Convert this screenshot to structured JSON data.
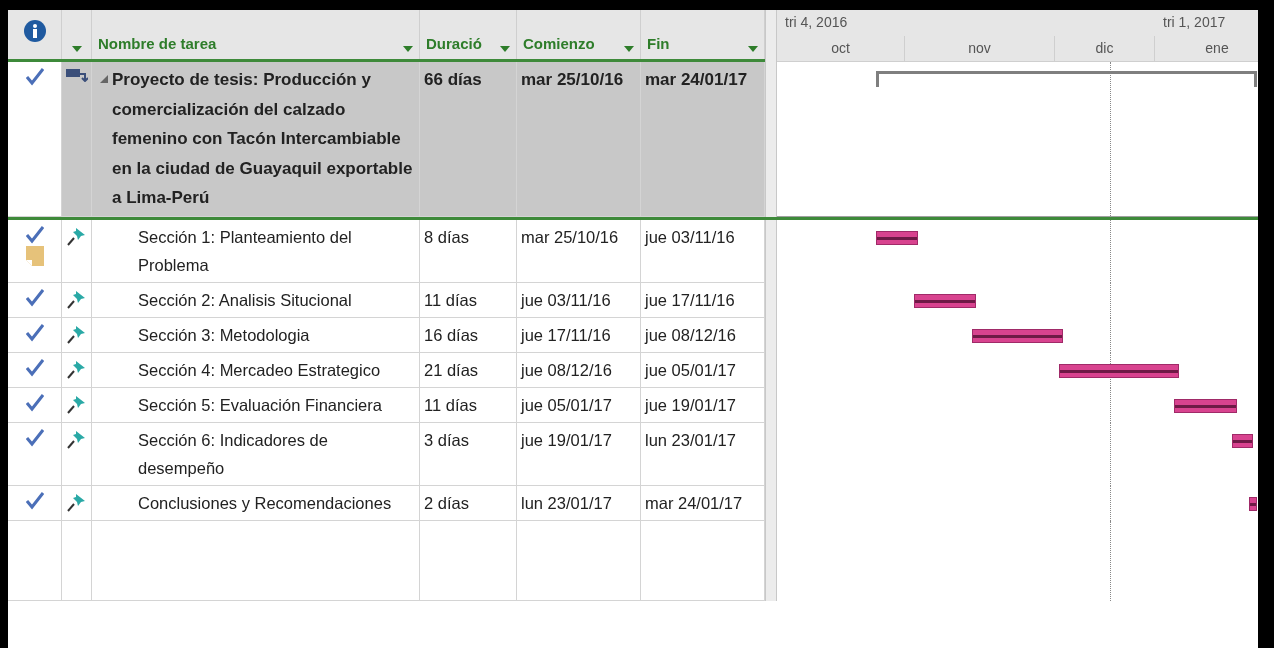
{
  "columns": [
    {
      "kind": "info"
    },
    {
      "kind": "mode"
    },
    {
      "kind": "name",
      "label": "Nombre de tarea"
    },
    {
      "kind": "duration",
      "label": "Duració"
    },
    {
      "kind": "start",
      "label": "Comienzo"
    },
    {
      "kind": "finish",
      "label": "Fin"
    }
  ],
  "timescale": {
    "top": [
      {
        "label": "tri 4, 2016"
      },
      {
        "label": "tri 1, 2017"
      }
    ],
    "bottom": [
      {
        "label": "oct"
      },
      {
        "label": "nov"
      },
      {
        "label": "dic"
      },
      {
        "label": "ene"
      }
    ]
  },
  "tasks": [
    {
      "complete": true,
      "manual": false,
      "expanded": true,
      "name": "Proyecto de tesis: Producción y comercialización del calzado femenino con Tacón Intercambiable en la ciudad de Guayaquil exportable a Lima-Perú",
      "duration": "66 días",
      "start": "mar 25/10/16",
      "finish": "mar 24/01/17",
      "children": [
        {
          "complete": true,
          "manual": true,
          "has_note": true,
          "name": "Sección 1: Planteamiento del Problema",
          "duration": "8 días",
          "start": "mar 25/10/16",
          "finish": "jue 03/11/16"
        },
        {
          "complete": true,
          "manual": true,
          "name": "Sección 2: Analisis Situcional",
          "duration": "11 días",
          "start": "jue 03/11/16",
          "finish": "jue 17/11/16"
        },
        {
          "complete": true,
          "manual": true,
          "name": "Sección 3: Metodologia",
          "duration": "16 días",
          "start": "jue 17/11/16",
          "finish": "jue 08/12/16"
        },
        {
          "complete": true,
          "manual": true,
          "name": "Sección 4: Mercadeo Estrategico",
          "duration": "21 días",
          "start": "jue 08/12/16",
          "finish": "jue 05/01/17"
        },
        {
          "complete": true,
          "manual": true,
          "name": "Sección 5: Evaluación Financiera",
          "duration": "11 días",
          "start": "jue 05/01/17",
          "finish": "jue 19/01/17"
        },
        {
          "complete": true,
          "manual": true,
          "name": "Sección 6: Indicadores de desempeño",
          "duration": "3 días",
          "start": "jue 19/01/17",
          "finish": "lun 23/01/17"
        },
        {
          "complete": true,
          "manual": true,
          "name": "Conclusiones y Recomendaciones",
          "duration": "2 días",
          "start": "lun 23/01/17",
          "finish": "mar 24/01/17"
        }
      ]
    }
  ]
}
